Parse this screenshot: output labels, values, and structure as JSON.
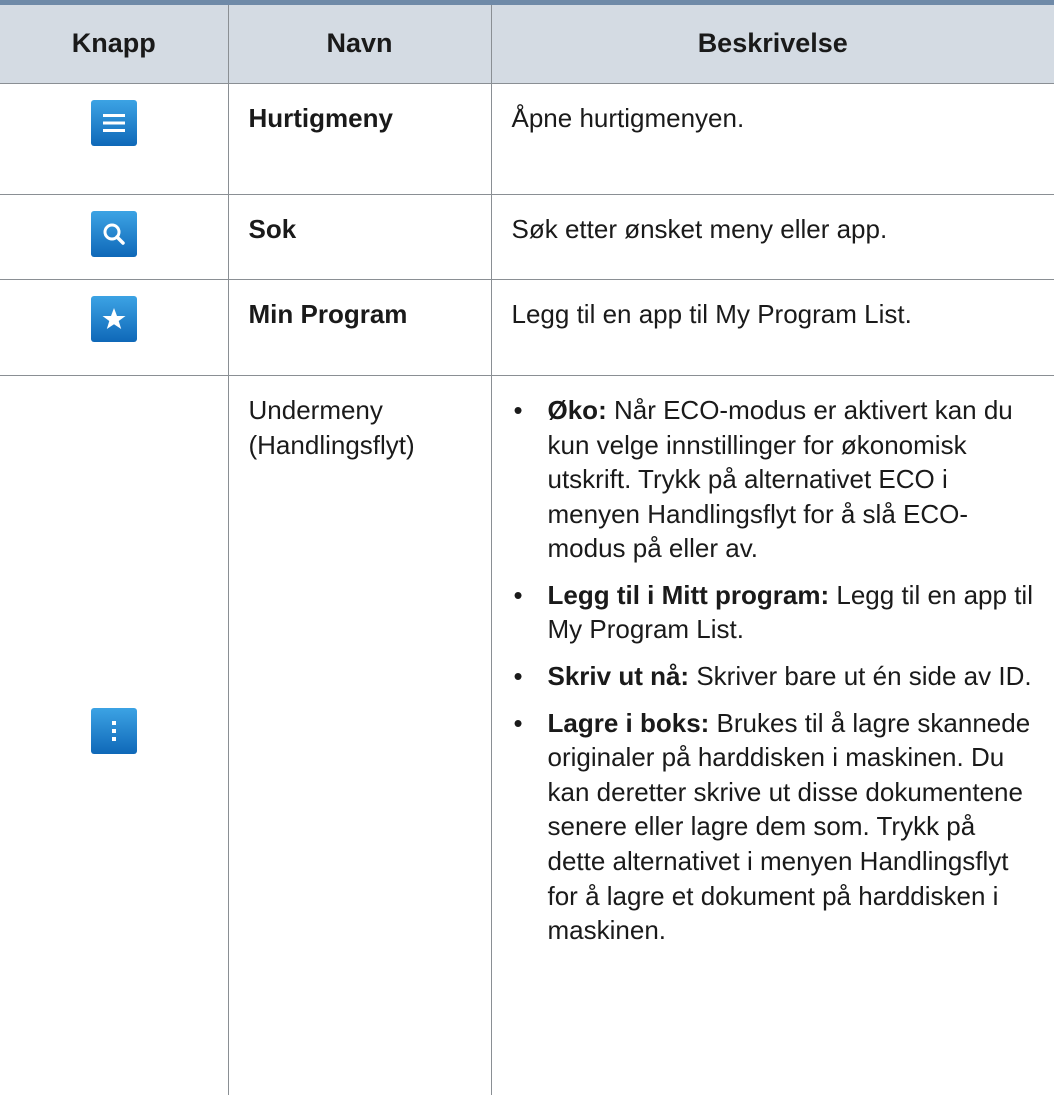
{
  "table": {
    "headers": [
      "Knapp",
      "Navn",
      "Beskrivelse"
    ],
    "rows": [
      {
        "icon": "hamburger-menu-icon",
        "name": "Hurtigmeny",
        "description": "Åpne hurtigmenyen."
      },
      {
        "icon": "search-icon",
        "name": "Sok",
        "description": "Søk etter ønsket meny eller app."
      },
      {
        "icon": "star-icon",
        "name": "Min Program",
        "description": "Legg til en app til My Program List."
      },
      {
        "icon": "more-vertical-icon",
        "name_line1": "Undermeny",
        "name_line2": "(Handlingsflyt)",
        "bullets": [
          {
            "label": "Øko:",
            "text": " Når ECO-modus er aktivert kan du kun velge innstillinger for økonomisk utskrift. Trykk på alternativet ECO i menyen Handlingsflyt for å slå ECO-modus på eller av."
          },
          {
            "label": "Legg til i Mitt program:",
            "text": " Legg til en app til My Program List."
          },
          {
            "label": "Skriv ut nå:",
            "text": " Skriver bare ut én side av ID."
          },
          {
            "label": "Lagre i boks:",
            "text": " Brukes til å lagre skannede originaler på harddisken i maskinen. Du kan deretter skrive ut disse dokumentene senere eller lagre dem som. Trykk på dette alternativet i menyen Handlingsflyt for å lagre et dokument på harddisken i maskinen."
          }
        ]
      }
    ]
  },
  "colors": {
    "header_bg": "#d4dbe3",
    "header_top_rule": "#6f8aa8",
    "icon_gradient_top": "#3ca3e4",
    "icon_gradient_bottom": "#0f68b8"
  }
}
